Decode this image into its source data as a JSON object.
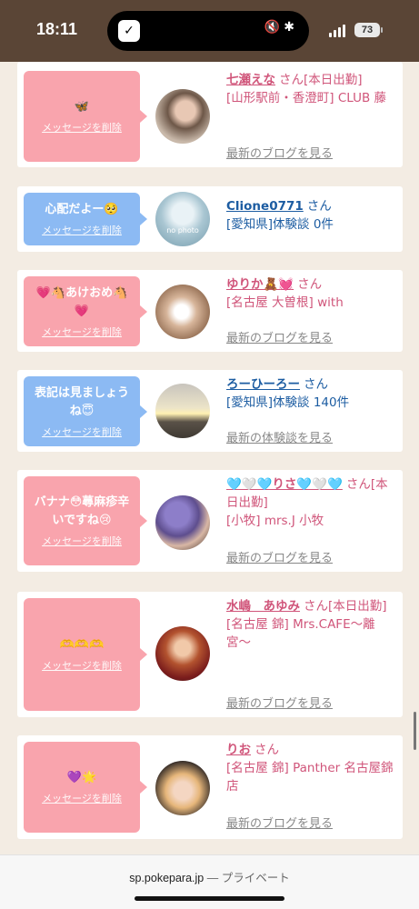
{
  "status": {
    "time": "18:11",
    "battery": "73"
  },
  "delete_label": "メッセージを削除",
  "blog_label": "最新のブログを見る",
  "review_label": "最新の体験談を見る",
  "san": "さん",
  "cards": [
    {
      "message": "🦋",
      "name": "七瀬えな",
      "tag": "[本日出勤]",
      "sub": "[山形駅前・香澄町] CLUB 藤",
      "link": "最新のブログを見る"
    },
    {
      "message": "心配だよー🥺",
      "name": "Clione0771",
      "sub": "[愛知県]体験談 0件",
      "avatar_text": "no photo"
    },
    {
      "message": "💗🐴あけおめ🐴💗",
      "name": "ゆりか🧸💓",
      "sub": "[名古屋 大曽根] with",
      "link": "最新のブログを見る"
    },
    {
      "message": "表記は見ましょうね😇",
      "name": "ろーひーろー",
      "sub": "[愛知県]体験談 140件",
      "link": "最新の体験談を見る"
    },
    {
      "message": "バナナ😳蕁麻疹辛いですね😢",
      "name": "🩵🤍🩵りさ🩵🤍🩵",
      "tag": "[本日出勤]",
      "sub": "[小牧] mrs.J 小牧",
      "link": "最新のブログを見る"
    },
    {
      "message": "🫶🫶🫶",
      "name": "水嶋　あゆみ",
      "tag": "[本日出勤]",
      "sub": "[名古屋 錦] Mrs.CAFE〜離宮〜",
      "link": "最新のブログを見る"
    },
    {
      "message": "💜🌟",
      "name": "りお",
      "sub": "[名古屋 錦] Panther 名古屋錦店",
      "link": "最新のブログを見る"
    }
  ],
  "url_bar": {
    "domain": "sp.pokepara.jp",
    "separator": " — ",
    "label": "プライベート"
  }
}
